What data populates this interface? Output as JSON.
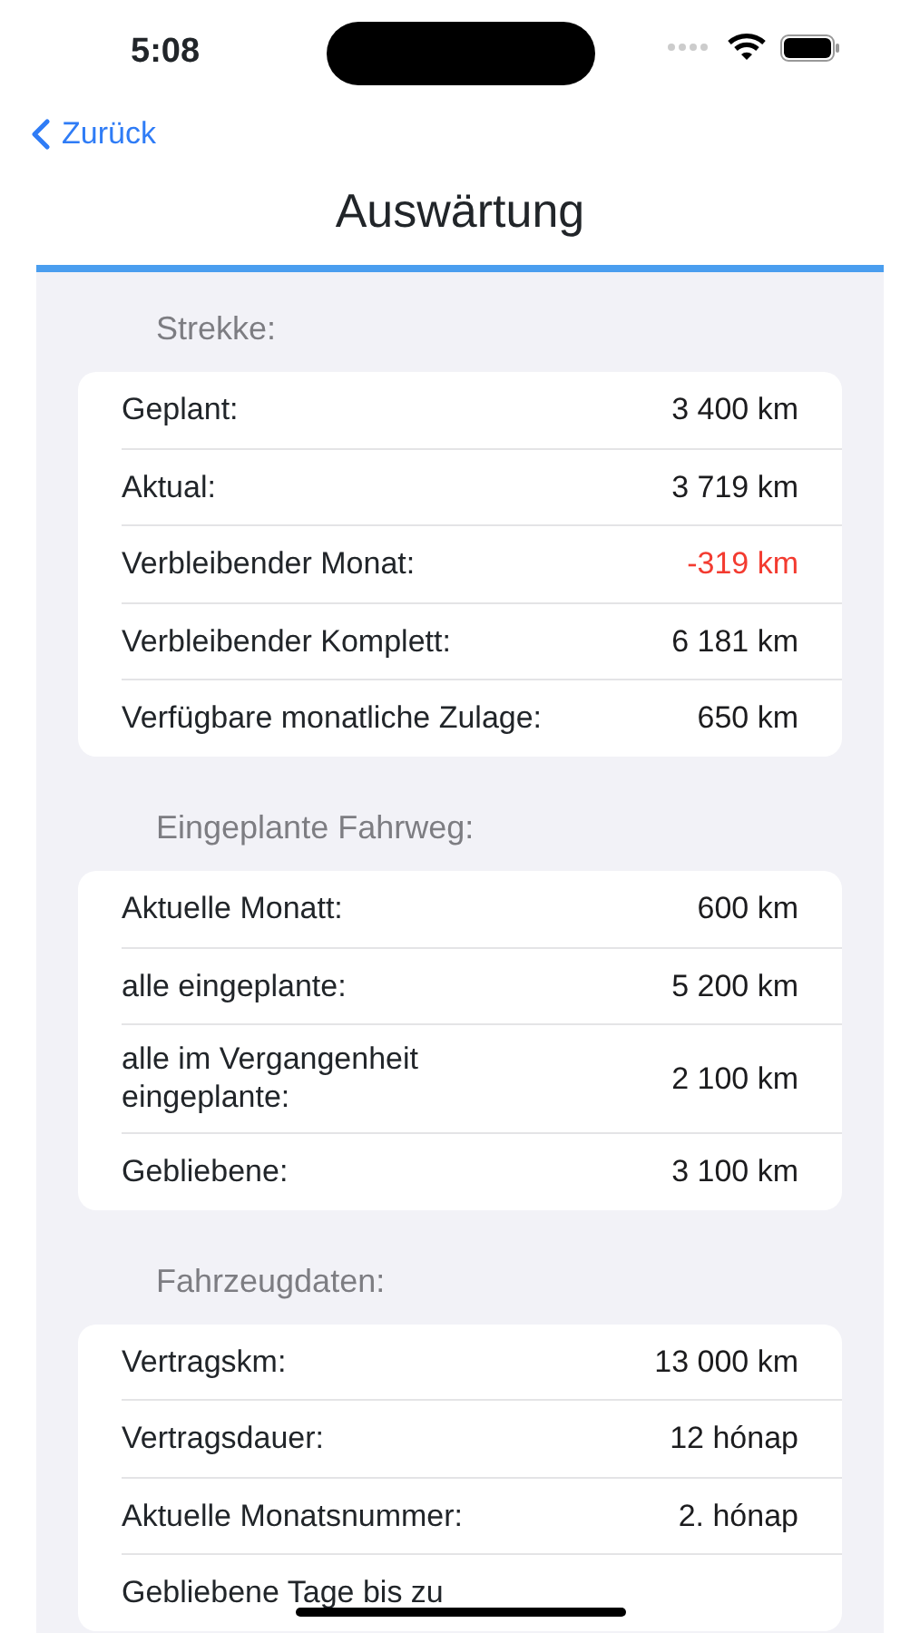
{
  "status_bar": {
    "time": "5:08"
  },
  "nav": {
    "back": "Zurück",
    "title": "Auswärtung"
  },
  "sections": [
    {
      "header": "Strekke:",
      "rows": [
        {
          "label": "Geplant:",
          "value": "3 400 km",
          "color": "#1c1c1e"
        },
        {
          "label": "Aktual:",
          "value": "3 719 km",
          "color": "#1c1c1e"
        },
        {
          "label": "Verbleibender Monat:",
          "value": "-319 km",
          "color": "#f33b30"
        },
        {
          "label": "Verbleibender Komplett:",
          "value": "6 181 km",
          "color": "#1c1c1e"
        },
        {
          "label": "Verfügbare monatliche Zulage:",
          "value": "650 km",
          "color": "#1c1c1e"
        }
      ]
    },
    {
      "header": "Eingeplante Fahrweg:",
      "rows": [
        {
          "label": "Aktuelle Monatt:",
          "value": "600 km",
          "color": "#1c1c1e"
        },
        {
          "label": "alle eingeplante:",
          "value": "5 200 km",
          "color": "#1c1c1e"
        },
        {
          "label": "alle im Vergangenheit\neingeplante:",
          "value": "2 100 km",
          "color": "#1c1c1e"
        },
        {
          "label": "Gebliebene:",
          "value": "3 100 km",
          "color": "#1c1c1e"
        }
      ]
    },
    {
      "header": "Fahrzeugdaten:",
      "rows": [
        {
          "label": "Vertragskm:",
          "value": "13 000 km",
          "color": "#1c1c1e"
        },
        {
          "label": "Vertragsdauer:",
          "value": "12 hónap",
          "color": "#1c1c1e"
        },
        {
          "label": "Aktuelle Monatsnummer:",
          "value": "2. hónap",
          "color": "#1c1c1e"
        },
        {
          "label": "Gebliebene Tage bis zu"
        }
      ]
    }
  ]
}
